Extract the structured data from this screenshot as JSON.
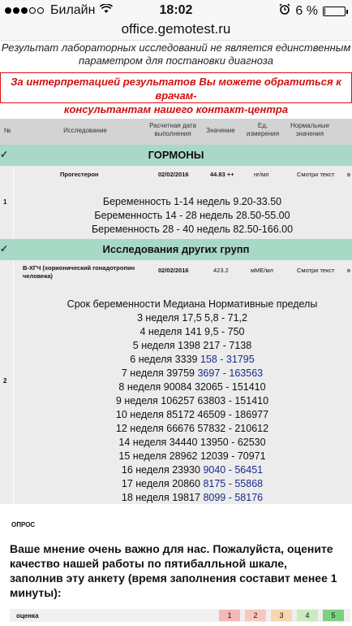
{
  "status_bar": {
    "carrier": "Билайн",
    "time": "18:02",
    "battery_percent": "6 %",
    "battery_level": 0.06,
    "icons": [
      "signal-dots-icon",
      "wifi-icon",
      "alarm-icon",
      "battery-icon"
    ]
  },
  "browser": {
    "url": "office.gemotest.ru"
  },
  "notices": {
    "gray_line1": "Результат лабораторных исследований не является единственным",
    "gray_line2": "параметром для постановки диагноза",
    "red_line1": "За интерпретацией результатов Вы можете обратиться к врачам-",
    "red_line2": "консультантам нашего контакт-центра"
  },
  "table": {
    "headers": {
      "no": "№",
      "test": "Исследование",
      "date": "Расчетная дата выполнения",
      "value": "Значение",
      "unit": "Ед. измерения",
      "normal": "Нормальные значения"
    },
    "groups": [
      {
        "title": "ГОРМОНЫ",
        "row": {
          "num": "1",
          "test": "Прогестерон",
          "date": "02/02/2016",
          "value": "44.83 ++",
          "unit": "нг/мл",
          "normal": "Смотри текст",
          "extra": "в",
          "description": [
            "Беременность 1-14 недель 9.20-33.50",
            "Беременность 14 - 28 недель 28.50-55.00",
            "Беременность 28 - 40 недель 82.50-166.00"
          ]
        }
      },
      {
        "title": "Исследования других групп",
        "row": {
          "num": "2",
          "test": "В-ХГЧ (хорионический гонадотропин человека)",
          "date": "02/02/2016",
          "value": "423.2",
          "unit": "мМЕ/мл",
          "normal": "Смотри текст",
          "extra": "в",
          "description_header": "Срок беременности Медиана Нормативные пределы",
          "weeks": [
            {
              "text": "3 неделя 17,5 5,8 - 71,2",
              "range": ""
            },
            {
              "text": "4 неделя 141 9,5 - 750",
              "range": ""
            },
            {
              "text": "5 неделя 1398 217 - 7138",
              "range": ""
            },
            {
              "text": "6 неделя 3339 ",
              "range": "158 - 31795"
            },
            {
              "text": "7 неделя 39759 ",
              "range": "3697 - 163563"
            },
            {
              "text": "8 неделя 90084 32065 - 151410",
              "range": ""
            },
            {
              "text": "9 неделя 106257 63803 - 151410",
              "range": ""
            },
            {
              "text": "10 неделя 85172 46509 - 186977",
              "range": ""
            },
            {
              "text": "12 неделя 66676 57832 - 210612",
              "range": ""
            },
            {
              "text": "14 неделя 34440 13950 - 62530",
              "range": ""
            },
            {
              "text": "15 неделя 28962 12039 - 70971",
              "range": ""
            },
            {
              "text": "16 неделя 23930 ",
              "range": "9040 - 56451"
            },
            {
              "text": "17 неделя 20860 ",
              "range": "8175 - 55868"
            },
            {
              "text": "18 неделя 19817 ",
              "range": "8099 - 58176"
            }
          ]
        }
      }
    ]
  },
  "poll": {
    "label": "ОПРОС",
    "question": "Ваше мнение очень важно для нас. Пожалуйста, оцените качество нашей работы по пятибалльной шкале, заполнив эту анкету (время заполнения составит менее 1 минуты):",
    "rating_label": "оценка",
    "ratings": [
      "1",
      "2",
      "3",
      "4",
      "5"
    ],
    "rating_colors": [
      "#f4b8b8",
      "#f8c8c0",
      "#f8d6b0",
      "#c8ecc0",
      "#7ed07e"
    ]
  },
  "colors": {
    "group_header": "#a8d8c6",
    "row_bg": "#ececec",
    "header_bg": "#d3d3d3",
    "red_notice": "#d01010",
    "blue_range": "#1a2a8a"
  }
}
